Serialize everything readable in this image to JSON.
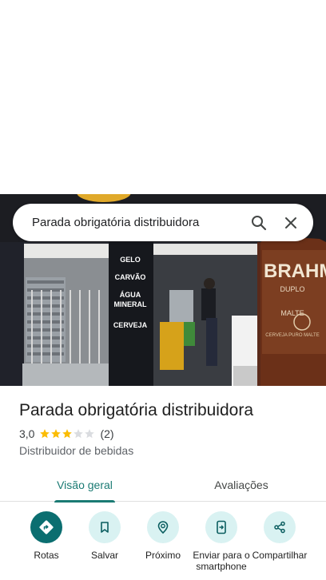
{
  "search": {
    "query": "Parada obrigatória distribuidora"
  },
  "photo": {
    "sign_words": [
      "GELO",
      "CARVÃO",
      "ÁGUA",
      "MINERAL",
      "CERVEJA"
    ],
    "bottle_brand": "BRAHM",
    "bottle_sub1": "DUPLO",
    "bottle_sub2": "MALTE",
    "bottle_bottom": "CERVEJA PURO MALTE"
  },
  "place": {
    "name": "Parada obrigatória distribuidora",
    "rating": "3,0",
    "rating_stars": 3,
    "review_count": "(2)",
    "category": "Distribuidor de bebidas"
  },
  "tabs": [
    {
      "label": "Visão geral",
      "active": true
    },
    {
      "label": "Avaliações",
      "active": false
    }
  ],
  "actions": [
    {
      "label": "Rotas",
      "icon": "directions-icon"
    },
    {
      "label": "Salvar",
      "icon": "bookmark-icon"
    },
    {
      "label": "Próximo",
      "icon": "nearby-icon"
    },
    {
      "label": "Enviar para o smartphone",
      "icon": "send-to-phone-icon"
    },
    {
      "label": "Compartilhar",
      "icon": "share-icon"
    }
  ],
  "colors": {
    "accent": "#1a7a73",
    "primary_action": "#0b6e70",
    "action_bg": "#d9f2f2",
    "star_filled": "#fbbc04",
    "star_empty": "#dadce0"
  }
}
